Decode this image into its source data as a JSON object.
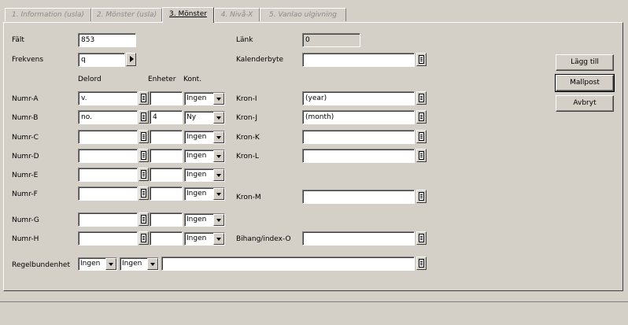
{
  "tabs": [
    "1. Information (usla)",
    "2. Mönster (usla)",
    "3. Mönster",
    "4. Nivå-X",
    "5. Vanlao ulgivning"
  ],
  "fields": {
    "falt_label": "Fält",
    "falt_value": "853",
    "frekvens_label": "Frekvens",
    "frekvens_value": "q",
    "lank_label": "Länk",
    "lank_value": "0",
    "kalenderbyte_label": "Kalenderbyte",
    "kalenderbyte_value": ""
  },
  "columns": {
    "delord": "Delord",
    "enheter": "Enheter",
    "kont": "Kont."
  },
  "numr_rows": [
    {
      "label": "Numr-A",
      "delord": "v.",
      "enheter": "",
      "kont": "Ingen"
    },
    {
      "label": "Numr-B",
      "delord": "no.",
      "enheter": "4",
      "kont": "Ny"
    },
    {
      "label": "Numr-C",
      "delord": "",
      "enheter": "",
      "kont": "Ingen"
    },
    {
      "label": "Numr-D",
      "delord": "",
      "enheter": "",
      "kont": "Ingen"
    },
    {
      "label": "Numr-E",
      "delord": "",
      "enheter": "",
      "kont": "Ingen"
    },
    {
      "label": "Numr-F",
      "delord": "",
      "enheter": "",
      "kont": "Ingen"
    },
    {
      "label": "Numr-G",
      "delord": "",
      "enheter": "",
      "kont": "Ingen"
    },
    {
      "label": "Numr-H",
      "delord": "",
      "enheter": "",
      "kont": "Ingen"
    }
  ],
  "kron_rows": [
    {
      "label": "Kron-I",
      "value": "(year)"
    },
    {
      "label": "Kron-J",
      "value": "(month)"
    },
    {
      "label": "Kron-K",
      "value": ""
    },
    {
      "label": "Kron-L",
      "value": ""
    },
    {
      "label": "Kron-M",
      "value": ""
    },
    {
      "label": "Bihang/index-O",
      "value": ""
    }
  ],
  "regel": {
    "label": "Regelbundenhet",
    "combo1": "Ingen",
    "combo2": "Ingen",
    "value": ""
  },
  "buttons": {
    "add": "Lägg till",
    "template": "Mallpost",
    "cancel": "Avbryt"
  }
}
